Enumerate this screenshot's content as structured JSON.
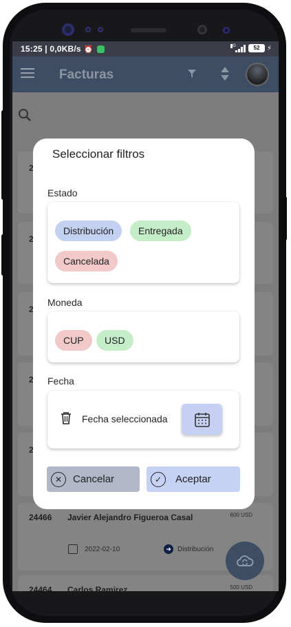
{
  "status_bar": {
    "time": "15:25 | 0,0KB/s",
    "network": "4G",
    "battery": "52"
  },
  "app_bar": {
    "title": "Facturas"
  },
  "background": {
    "peek_numbers": [
      "29",
      "28",
      "24",
      "24",
      "24"
    ],
    "invoice_card": {
      "id": "24466",
      "client": "Javier Alejandro Figueroa Casal",
      "amount": "600 USD",
      "date": "2022-02-10",
      "status": "Distribución"
    },
    "next_card": {
      "id": "24464",
      "client": "Carlos Ramirez",
      "amount": "500 USD"
    }
  },
  "dialog": {
    "title": "Seleccionar filtros",
    "estado": {
      "label": "Estado",
      "chips": [
        "Distribución",
        "Entregada",
        "Cancelada"
      ]
    },
    "moneda": {
      "label": "Moneda",
      "chips": [
        "CUP",
        "USD"
      ]
    },
    "fecha": {
      "label": "Fecha",
      "selected_text": "Fecha seleccionada"
    },
    "cancel_label": "Cancelar",
    "accept_label": "Aceptar"
  },
  "colors": {
    "chip_blue": "#c3d1f0",
    "chip_green": "#c5edc8",
    "chip_red": "#f2c9c9",
    "accept_button": "#c6d2f3",
    "cancel_button": "#b3b8c8",
    "app_bar": "#3d4d63"
  },
  "icons": {
    "menu": "menu-icon",
    "filter": "filter-icon",
    "sort": "sort-icon",
    "search": "search-icon",
    "trash": "trash-icon",
    "calendar": "calendar-icon",
    "cancel": "close-circle-icon",
    "accept": "check-circle-icon",
    "fab": "cloud-sync-icon"
  }
}
